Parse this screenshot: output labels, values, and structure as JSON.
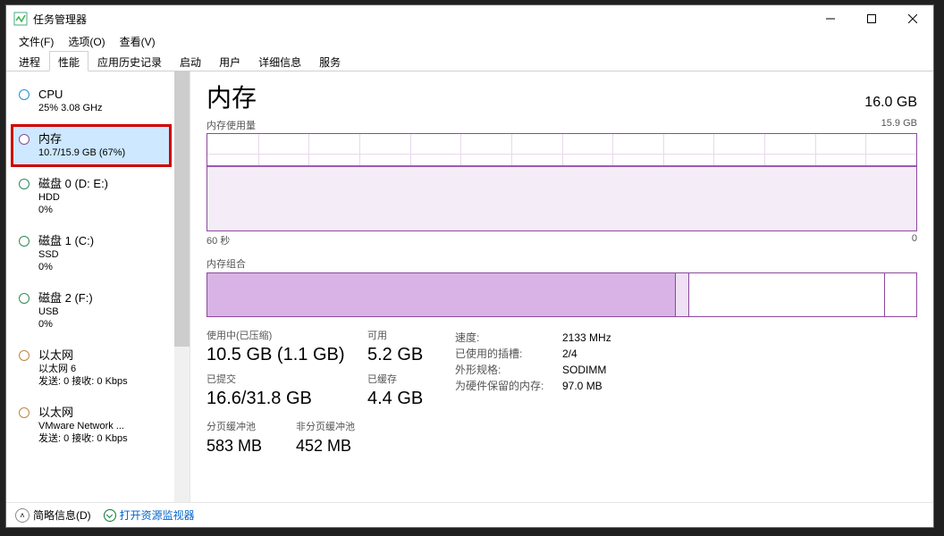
{
  "title": "任务管理器",
  "menus": {
    "file": "文件(F)",
    "options": "选项(O)",
    "view": "查看(V)"
  },
  "tabs": [
    "进程",
    "性能",
    "应用历史记录",
    "启动",
    "用户",
    "详细信息",
    "服务"
  ],
  "active_tab_index": 1,
  "sidebar": {
    "items": [
      {
        "name": "CPU",
        "sub": "25% 3.08 GHz",
        "sub2": "",
        "color": "#1e90d2",
        "selected": false
      },
      {
        "name": "内存",
        "sub": "10.7/15.9 GB (67%)",
        "sub2": "",
        "color": "#8b4a9c",
        "selected": true
      },
      {
        "name": "磁盘 0 (D: E:)",
        "sub": "HDD",
        "sub2": "0%",
        "color": "#2e8b57",
        "selected": false
      },
      {
        "name": "磁盘 1 (C:)",
        "sub": "SSD",
        "sub2": "0%",
        "color": "#2e8b57",
        "selected": false
      },
      {
        "name": "磁盘 2 (F:)",
        "sub": "USB",
        "sub2": "0%",
        "color": "#2e8b57",
        "selected": false
      },
      {
        "name": "以太网",
        "sub": "以太网 6",
        "sub2": "发送: 0 接收: 0 Kbps",
        "color": "#c0843e",
        "selected": false
      },
      {
        "name": "以太网",
        "sub": "VMware Network ...",
        "sub2": "发送: 0 接收: 0 Kbps",
        "color": "#c0843e",
        "selected": false
      }
    ]
  },
  "header": {
    "title": "内存",
    "total": "16.0 GB"
  },
  "chart1": {
    "caption": "内存使用量",
    "max_label": "15.9 GB",
    "xleft": "60 秒",
    "xright": "0"
  },
  "chart2": {
    "caption": "内存组合"
  },
  "stats": {
    "in_use_label": "使用中(已压缩)",
    "in_use_value": "10.5 GB (1.1 GB)",
    "available_label": "可用",
    "available_value": "5.2 GB",
    "committed_label": "已提交",
    "committed_value": "16.6/31.8 GB",
    "cached_label": "已缓存",
    "cached_value": "4.4 GB",
    "paged_label": "分页缓冲池",
    "paged_value": "583 MB",
    "nonpaged_label": "非分页缓冲池",
    "nonpaged_value": "452 MB"
  },
  "info": {
    "speed_k": "速度:",
    "speed_v": "2133 MHz",
    "slots_k": "已使用的插槽:",
    "slots_v": "2/4",
    "form_k": "外形规格:",
    "form_v": "SODIMM",
    "reserved_k": "为硬件保留的内存:",
    "reserved_v": "97.0 MB"
  },
  "footer": {
    "fewer": "简略信息(D)",
    "resmon": "打开资源监视器"
  },
  "chart_data": {
    "type": "line",
    "title": "内存使用量",
    "ylabel": "GB",
    "ylim": [
      0,
      15.9
    ],
    "xrange_seconds": [
      60,
      0
    ],
    "series": [
      {
        "name": "使用中",
        "approx_constant_value": 10.7
      }
    ],
    "composition": {
      "total_gb": 15.9,
      "in_use_gb": 10.5,
      "modified_gb": 0.3,
      "standby_gb": 4.4,
      "free_gb": 0.7
    }
  }
}
